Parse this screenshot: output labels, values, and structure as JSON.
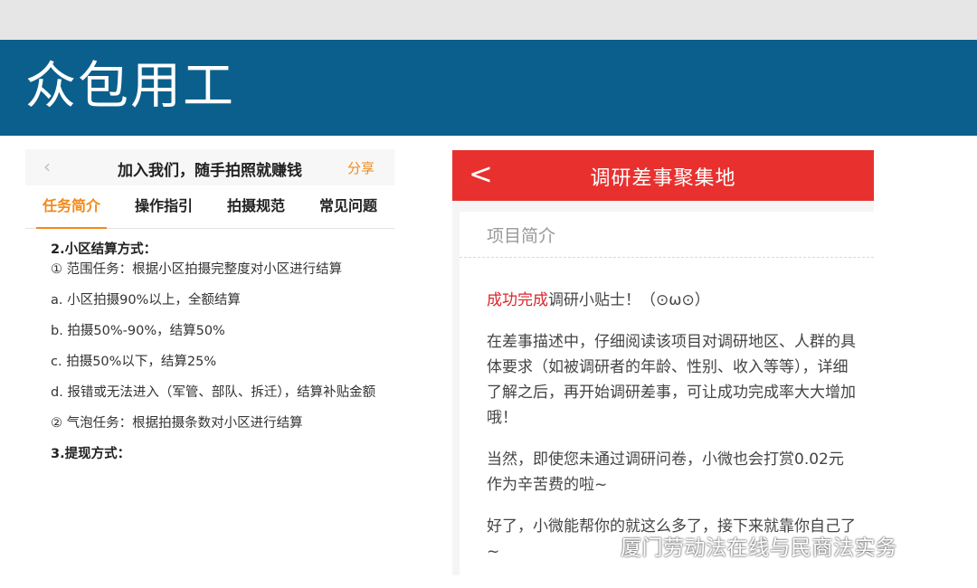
{
  "slide": {
    "title": "众包用工"
  },
  "left_screen": {
    "nav": {
      "back_icon": "‹",
      "title": "加入我们，随手拍照就赚钱",
      "share_label": "分享"
    },
    "tabs": [
      {
        "label": "任务简介",
        "active": true
      },
      {
        "label": "操作指引",
        "active": false
      },
      {
        "label": "拍摄规范",
        "active": false
      },
      {
        "label": "常见问题",
        "active": false
      }
    ],
    "content": {
      "heading_settlement": "2.小区结算方式：",
      "item_1": "① 范围任务：根据小区拍摄完整度对小区进行结算",
      "item_a": "a. 小区拍摄90%以上，全额结算",
      "item_b": "b. 拍摄50%-90%，结算50%",
      "item_c": "c. 拍摄50%以下，结算25%",
      "item_d": "d. 报错或无法进入（军管、部队、拆迁），结算补贴金额",
      "item_2": "② 气泡任务：根据拍摄条数对小区进行结算",
      "heading_withdraw": "3.提现方式："
    },
    "accent_color": "#f08a1c"
  },
  "right_screen": {
    "nav": {
      "back_icon": "<",
      "title": "调研差事聚集地"
    },
    "section_label": "项目简介",
    "tip_highlight": "成功完成",
    "tip_rest": "调研小贴士！（⊙ω⊙）",
    "paragraph_1": "在差事描述中，仔细阅读该项目对调研地区、人群的具体要求（如被调研者的年龄、性别、收入等等），详细了解之后，再开始调研差事，可让成功完成率大大增加哦！",
    "paragraph_2": "当然，即使您未通过调研问卷，小微也会打赏0.02元作为辛苦费的啦~",
    "paragraph_3": "好了，小微能帮你的就这么多了，接下来就靠你自己了~",
    "nav_color": "#e8312f"
  },
  "watermark": {
    "icon": "wechat-icon",
    "text": "厦门劳动法在线与民商法实务"
  }
}
